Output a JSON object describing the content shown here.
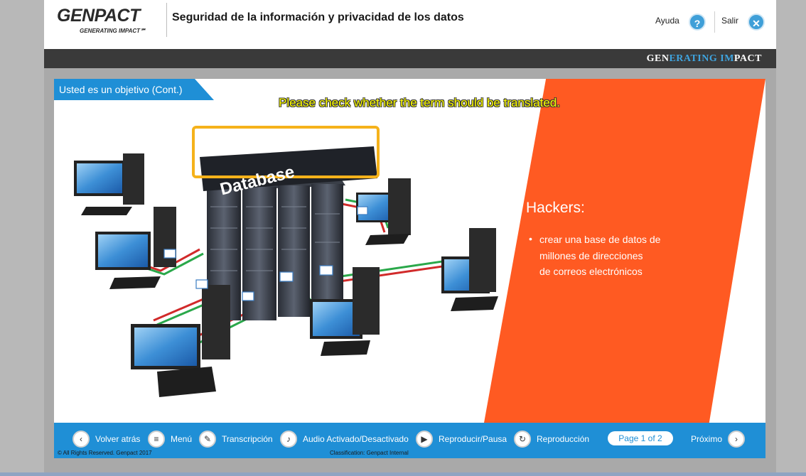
{
  "header": {
    "logo_main": "GENPACT",
    "logo_tagline": "GENERATING IMPACT℠",
    "course_title": "Seguridad de la información y privacidad de los datos",
    "help_label": "Ayuda",
    "help_icon": "?",
    "exit_label": "Salir",
    "exit_icon": "✕"
  },
  "band": {
    "brand_part1": "GEN",
    "brand_part2": "ERATING ",
    "brand_part3": "IM",
    "brand_part4": "PACT"
  },
  "slide": {
    "tab_title": "Usted es un objetivo (Cont.)",
    "notice": "Please check whether the term should be translated.",
    "database_label": "Database",
    "hackers_title": "Hackers:",
    "bullet_symbol": "•",
    "bullet_text_lines": [
      "crear una base de datos de",
      "millones de direcciones",
      "de correos electrónicos"
    ]
  },
  "navbar": {
    "back_label": "Volver atrás",
    "menu_label": "Menú",
    "transcript_label": "Transcripción",
    "audio_label": "Audio Activado/Desactivado",
    "play_label": "Reproducir/Pausa",
    "replay_label": "Reproducción",
    "page_indicator": "Page 1 of 2",
    "next_label": "Próximo",
    "copyright": "© All Rights Reserved. Genpact 2017",
    "classification": "Classification: Genpact Internal"
  },
  "colors": {
    "accent_blue": "#1f8fd6",
    "orange": "#ff5a22",
    "notice_yellow": "#ffff00",
    "highlight_box": "#f5b21b"
  }
}
